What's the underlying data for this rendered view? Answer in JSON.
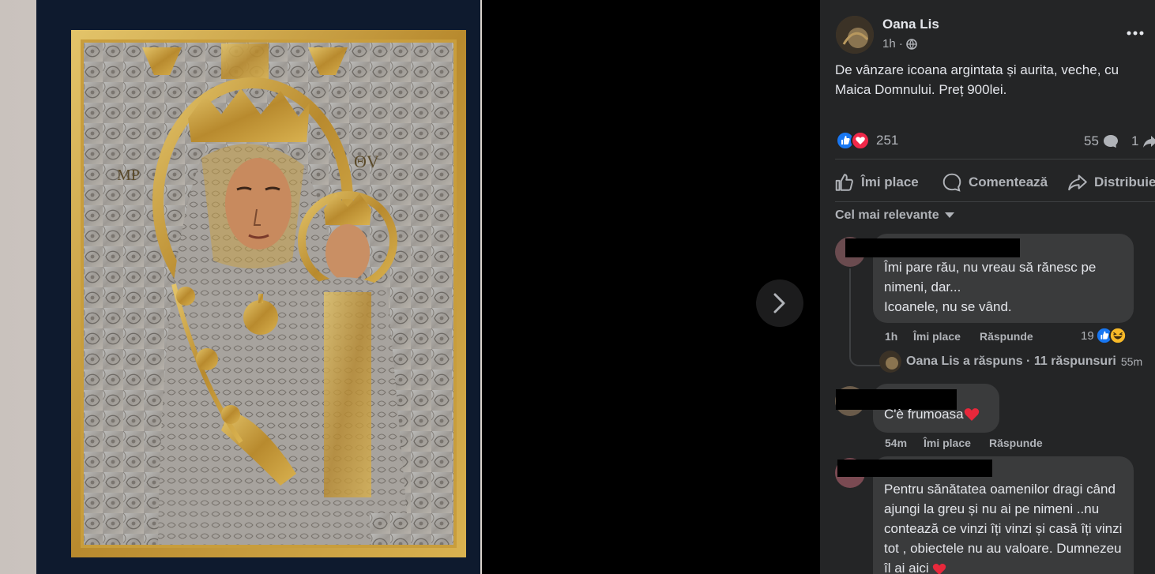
{
  "post": {
    "author": "Oana Lis",
    "time": "1h ·",
    "text": "De vânzare icoana argintata și aurita, veche, cu Maica Domnului. Preț 900lei.",
    "reactions_count": "251",
    "comments_count": "55",
    "shares_count": "1"
  },
  "actions": {
    "like": "Îmi place",
    "comment": "Comentează",
    "share": "Distribuie"
  },
  "sort_label": "Cel mai relevante",
  "comments": [
    {
      "text": "Îmi pare rău, nu vreau să rănesc pe nimeni, dar...\nIcoanele, nu se vând.",
      "time": "1h",
      "like_label": "Îmi place",
      "reply_label": "Răspunde",
      "reaction_count": "19",
      "replies_summary": "Oana Lis a răspuns · 11 răspunsuri",
      "replies_time": "55m"
    },
    {
      "text": "C'è frumoasa",
      "time": "54m",
      "like_label": "Îmi place",
      "reply_label": "Răspunde"
    },
    {
      "text": "Pentru sănătatea oamenilor dragi când ajungi la greu și nu ai pe nimeni ..nu contează ce vinzi îți vinzi și casă îți vinzi tot , obiectele nu au valoare. Dumnezeu îl ai aici"
    }
  ],
  "colors": {
    "panel_bg": "#242526",
    "bubble_bg": "#3a3b3c",
    "like_blue": "#1877f2",
    "love_red": "#f02849",
    "icon_gold": "#d4a93c"
  }
}
